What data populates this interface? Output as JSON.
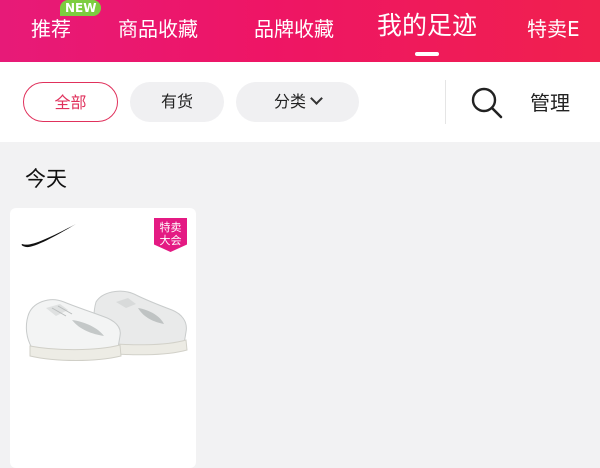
{
  "header": {
    "tabs": [
      {
        "label": "推荐",
        "badge": "NEW"
      },
      {
        "label": "商品收藏"
      },
      {
        "label": "品牌收藏"
      },
      {
        "label": "我的足迹",
        "active": true
      },
      {
        "label": "特卖E"
      }
    ],
    "colors": {
      "gradient_start": "#e71a78",
      "gradient_end": "#f0204e",
      "badge": "#7ccd3f"
    }
  },
  "filters": {
    "chips": [
      {
        "label": "全部",
        "selected": true
      },
      {
        "label": "有货"
      },
      {
        "label": "分类",
        "icon": "chevron-down-icon"
      }
    ],
    "search_icon": "search-icon",
    "manage_label": "管理"
  },
  "content": {
    "section_title": "今天",
    "products": [
      {
        "brand_icon": "nike-swoosh-logo",
        "tag_line1": "特卖",
        "tag_line2": "大会",
        "image_icon": "white-sneaker-image"
      }
    ]
  },
  "colors": {
    "accent": "#e0315c",
    "tag": "#e41a83",
    "background": "#f2f2f3"
  }
}
